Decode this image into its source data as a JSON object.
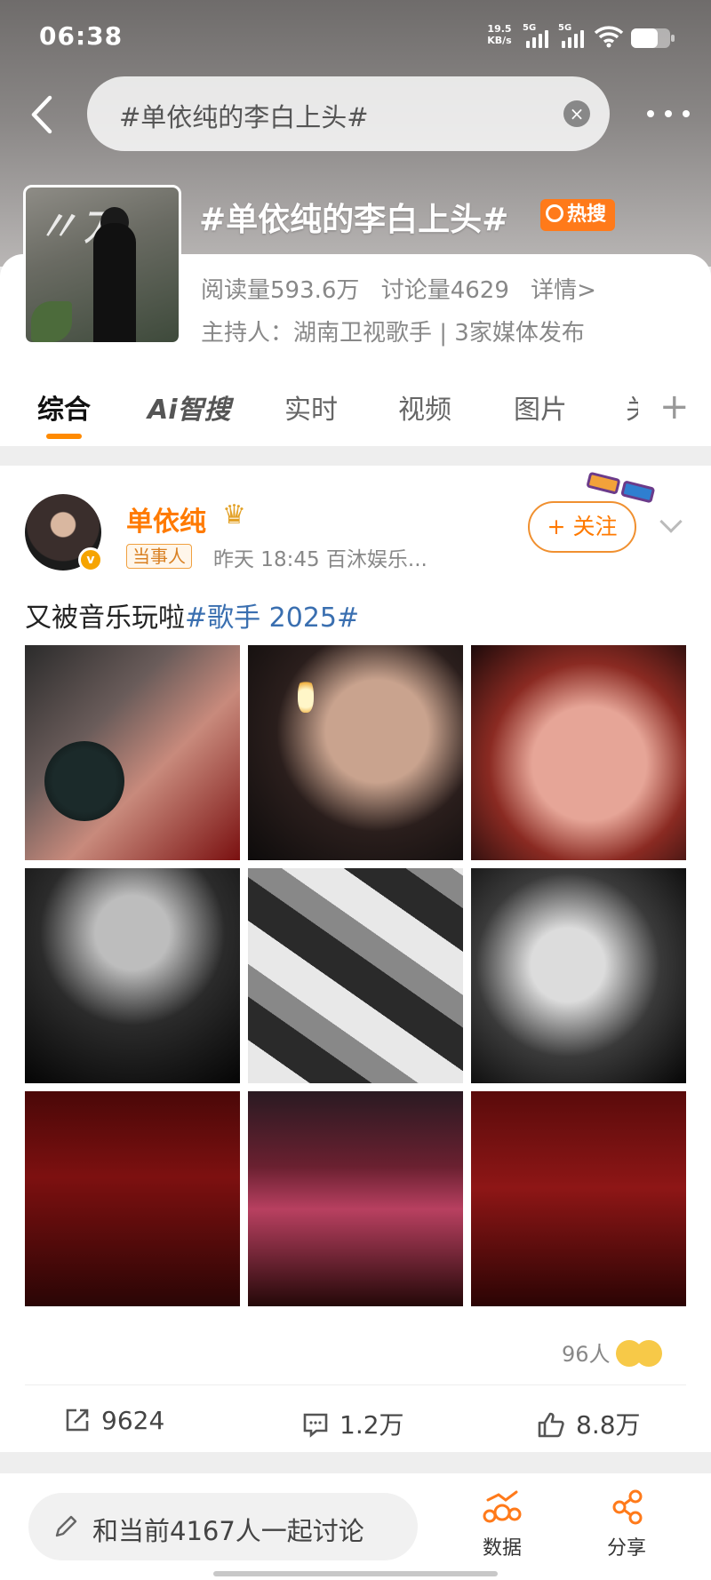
{
  "status": {
    "time": "06:38",
    "speed_value": "19.5",
    "speed_unit": "KB/s",
    "sim1": "5G",
    "sim2": "5G"
  },
  "search": {
    "query": "#单依纯的李白上头#",
    "clear": "×"
  },
  "topic": {
    "title": "#单依纯的李白上头#",
    "badge": "热搜",
    "reads": "阅读量593.6万",
    "discussions": "讨论量4629",
    "details": "详情>",
    "host": "主持人：湖南卫视歌手 | 3家媒体发布"
  },
  "tabs": [
    {
      "label": "综合"
    },
    {
      "label": "Ai智搜"
    },
    {
      "label": "实时"
    },
    {
      "label": "视频"
    },
    {
      "label": "图片"
    },
    {
      "label": "关"
    }
  ],
  "tabs_plus": "+",
  "post": {
    "username": "单依纯",
    "crown": "♛",
    "verified": "v",
    "role_tag": "当事人",
    "meta": "昨天 18:45  百沐娱乐...",
    "follow": "+ 关注",
    "text_plain": "又被音乐玩啦",
    "text_hashtag": "#歌手 2025#",
    "reactions_count": "96人",
    "reposts": "9624",
    "comments": "1.2万",
    "likes": "8.8万"
  },
  "bottom": {
    "discuss_placeholder": "和当前4167人一起讨论",
    "data_label": "数据",
    "share_label": "分享"
  }
}
